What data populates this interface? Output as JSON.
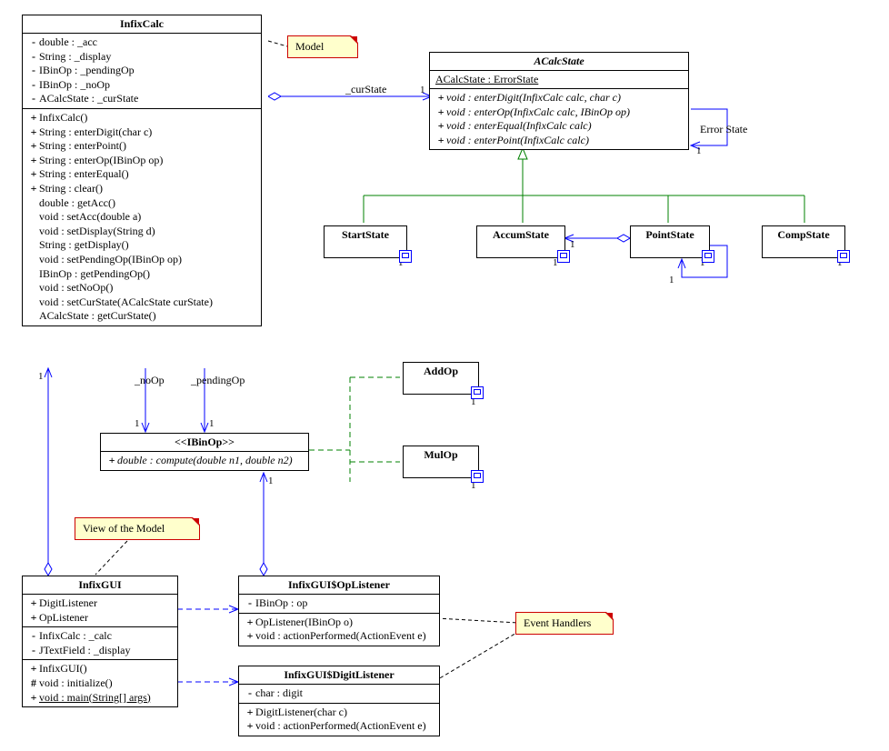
{
  "notes": {
    "model": "Model",
    "view": "View of the Model",
    "handlers": "Event Handlers"
  },
  "edges": {
    "curState": "_curState",
    "errorState": "Error State",
    "noOp": "_noOp",
    "pendingOp": "_pendingOp"
  },
  "mult1": "1",
  "classes": {
    "InfixCalc": {
      "title": "InfixCalc",
      "attrs": [
        {
          "v": "-",
          "t": "double : _acc"
        },
        {
          "v": "-",
          "t": "String : _display"
        },
        {
          "v": "-",
          "t": "IBinOp : _pendingOp"
        },
        {
          "v": "-",
          "t": "IBinOp : _noOp"
        },
        {
          "v": "-",
          "t": "ACalcState : _curState"
        }
      ],
      "ops": [
        {
          "v": "+",
          "t": "InfixCalc()"
        },
        {
          "v": "+",
          "t": "String : enterDigit(char c)"
        },
        {
          "v": "+",
          "t": "String : enterPoint()"
        },
        {
          "v": "+",
          "t": "String : enterOp(IBinOp op)"
        },
        {
          "v": "+",
          "t": "String : enterEqual()"
        },
        {
          "v": "+",
          "t": "String : clear()"
        },
        {
          "v": "",
          "t": "double : getAcc()"
        },
        {
          "v": "",
          "t": "void : setAcc(double a)"
        },
        {
          "v": "",
          "t": "void : setDisplay(String d)"
        },
        {
          "v": "",
          "t": "String : getDisplay()"
        },
        {
          "v": "",
          "t": "void : setPendingOp(IBinOp op)"
        },
        {
          "v": "",
          "t": "IBinOp : getPendingOp()"
        },
        {
          "v": "",
          "t": "void : setNoOp()"
        },
        {
          "v": "",
          "t": "void : setCurState(ACalcState curState)"
        },
        {
          "v": "",
          "t": "ACalcState : getCurState()"
        }
      ]
    },
    "ACalcState": {
      "title": "ACalcState",
      "subtitle": "ACalcState : ErrorState",
      "ops": [
        {
          "v": "+",
          "t": "void : enterDigit(InfixCalc calc, char c)",
          "i": true
        },
        {
          "v": "+",
          "t": "void : enterOp(InfixCalc calc, IBinOp op)",
          "i": true
        },
        {
          "v": "+",
          "t": "void : enterEqual(InfixCalc calc)",
          "i": true
        },
        {
          "v": "+",
          "t": "void : enterPoint(InfixCalc calc)",
          "i": true
        }
      ]
    },
    "StartState": {
      "title": "StartState"
    },
    "AccumState": {
      "title": "AccumState"
    },
    "PointState": {
      "title": "PointState"
    },
    "CompState": {
      "title": "CompState"
    },
    "IBinOp": {
      "stereo": "<<IBinOp>>",
      "op": {
        "v": "+",
        "t": "double : compute(double n1, double n2)",
        "i": true
      }
    },
    "AddOp": {
      "title": "AddOp"
    },
    "MulOp": {
      "title": "MulOp"
    },
    "InfixGUI": {
      "title": "InfixGUI",
      "inner": [
        {
          "v": "+",
          "t": "DigitListener"
        },
        {
          "v": "+",
          "t": "OpListener"
        }
      ],
      "attrs": [
        {
          "v": "-",
          "t": "InfixCalc : _calc"
        },
        {
          "v": "-",
          "t": "JTextField : _display"
        }
      ],
      "ops": [
        {
          "v": "+",
          "t": "InfixGUI()"
        },
        {
          "v": "#",
          "t": "void : initialize()"
        },
        {
          "v": "+",
          "t": "void : main(String[] args)",
          "u": true
        }
      ]
    },
    "OpListener": {
      "title": "InfixGUI$OpListener",
      "attrs": [
        {
          "v": "-",
          "t": "IBinOp : op"
        }
      ],
      "ops": [
        {
          "v": "+",
          "t": "OpListener(IBinOp o)"
        },
        {
          "v": "+",
          "t": "void : actionPerformed(ActionEvent e)"
        }
      ]
    },
    "DigitListener": {
      "title": "InfixGUI$DigitListener",
      "attrs": [
        {
          "v": "-",
          "t": "char : digit"
        }
      ],
      "ops": [
        {
          "v": "+",
          "t": "DigitListener(char c)"
        },
        {
          "v": "+",
          "t": "void : actionPerformed(ActionEvent e)"
        }
      ]
    }
  }
}
